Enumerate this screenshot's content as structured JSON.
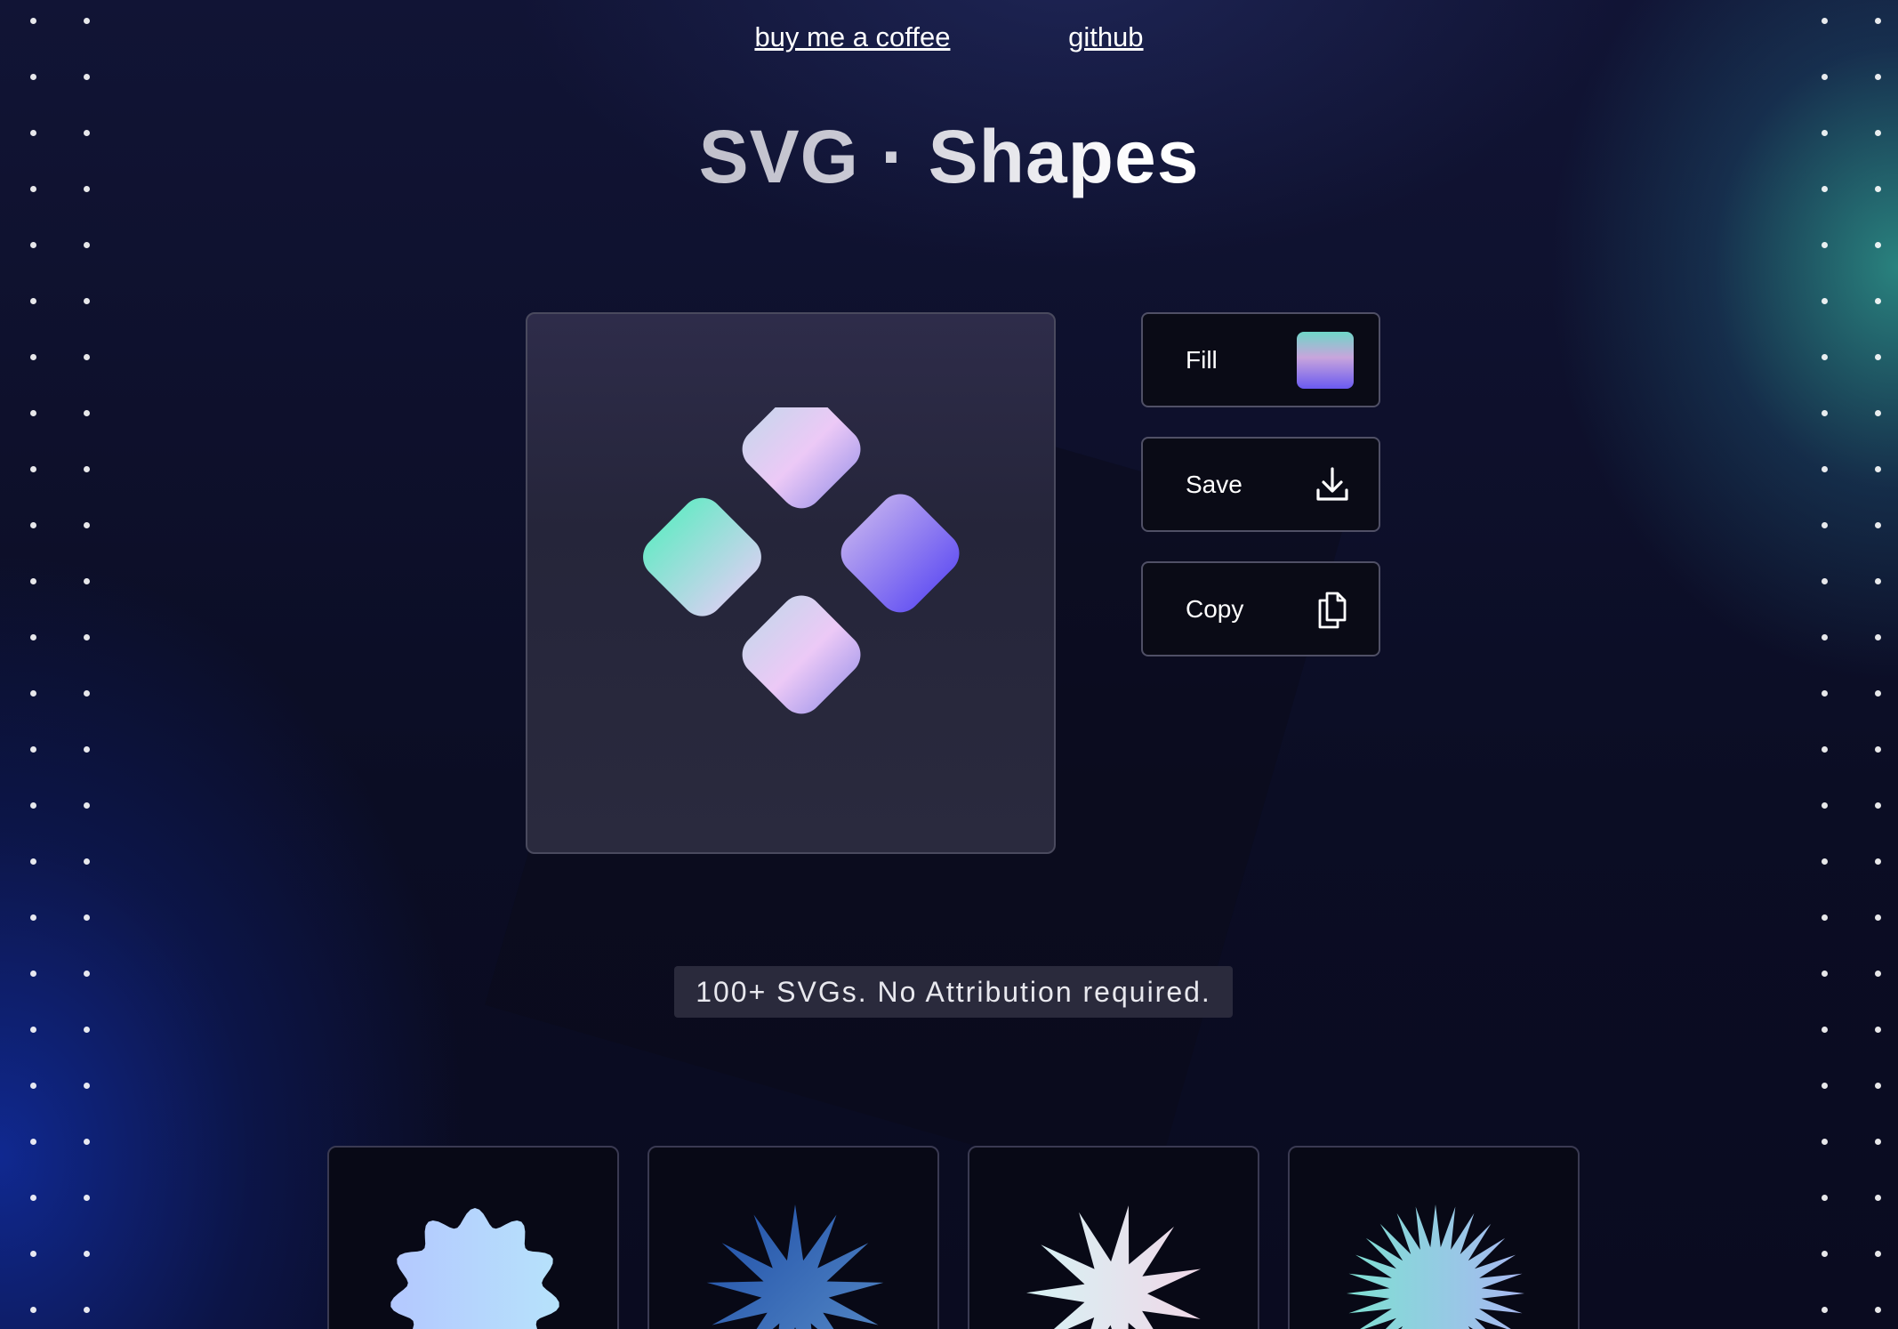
{
  "nav": {
    "coffee_label": "buy me a coffee",
    "github_label": "github"
  },
  "header": {
    "title": "SVG · Shapes"
  },
  "actions": {
    "fill_label": "Fill",
    "save_label": "Save",
    "copy_label": "Copy"
  },
  "tagline": "100+ SVGs. No Attribution required.",
  "icons": {
    "save": "download-icon",
    "copy": "copy-icon",
    "fill": "gradient-swatch"
  },
  "colors": {
    "background": "#0c0e26",
    "gradient_start": "#6fe0c8",
    "gradient_mid": "#e8c8f6",
    "gradient_end": "#6a58f2",
    "button_bg": "#0a0b16",
    "button_border": "#505066"
  },
  "gallery": {
    "items": [
      "blob-shape",
      "star-shape-blue",
      "star-shape-white",
      "starburst-shape-teal"
    ]
  }
}
